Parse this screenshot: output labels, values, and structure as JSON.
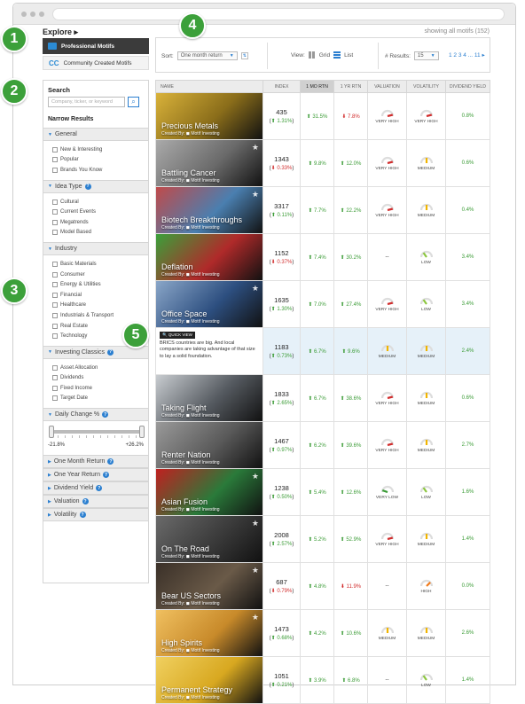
{
  "badges": [
    "1",
    "2",
    "3",
    "4",
    "5"
  ],
  "explore": "Explore",
  "showing": "showing all motifs (152)",
  "tabs": {
    "pro": "Professional Motifs",
    "community": "Community Created Motifs"
  },
  "toolbar": {
    "sort_label": "Sort:",
    "sort_value": "One month return",
    "view_label": "View:",
    "grid": "Grid",
    "list": "List",
    "results_label": "# Results:",
    "results_value": "15",
    "pages": "1  2  3  4 ... 11 ▸"
  },
  "sidebar": {
    "search_title": "Search",
    "search_placeholder": "Company, ticker, or keyword",
    "narrow": "Narrow Results",
    "general": {
      "title": "General",
      "items": [
        "New & Interesting",
        "Popular",
        "Brands You Know"
      ]
    },
    "idea": {
      "title": "Idea Type",
      "items": [
        "Cultural",
        "Current Events",
        "Megatrends",
        "Model Based"
      ]
    },
    "industry": {
      "title": "Industry",
      "items": [
        "Basic Materials",
        "Consumer",
        "Energy & Utilities",
        "Financial",
        "Healthcare",
        "Industrials & Transport",
        "Real Estate",
        "Technology"
      ]
    },
    "classics": {
      "title": "Investing Classics",
      "items": [
        "Asset Allocation",
        "Dividends",
        "Fixed Income",
        "Target Date"
      ]
    },
    "daily": {
      "title": "Daily Change %",
      "lo": "-21.8%",
      "hi": "+26.2%"
    },
    "collapsed": [
      "One Month Return",
      "One Year Return",
      "Dividend Yield",
      "Valuation",
      "Volatility"
    ]
  },
  "table": {
    "headers": [
      "NAME",
      "INDEX",
      "1 MO RTN",
      "1 YR RTN",
      "VALUATION",
      "VOLATILITY",
      "DIVIDEND YIELD"
    ],
    "created_by": "Created By:",
    "creator": "Motif Investing",
    "quick_view": "QUICK VIEW",
    "rows": [
      {
        "name": "Precious Metals",
        "index": "435",
        "change": "1.31%",
        "chg_dir": "up",
        "mo": "31.5%",
        "mo_dir": "up",
        "yr": "7.8%",
        "yr_dir": "dn",
        "val": "VERY HIGH",
        "vol": "VERY HIGH",
        "div": "0.8%",
        "bg": "#8a6d1a",
        "accent": "#d9b23a",
        "star": false
      },
      {
        "name": "Battling Cancer",
        "index": "1343",
        "change": "0.33%",
        "chg_dir": "dn",
        "mo": "9.8%",
        "mo_dir": "up",
        "yr": "12.0%",
        "yr_dir": "up",
        "val": "VERY HIGH",
        "vol": "MEDIUM",
        "div": "0.6%",
        "bg": "#6a6a6a",
        "accent": "#aaaaaa",
        "star": true
      },
      {
        "name": "Biotech Breakthroughs",
        "index": "3317",
        "change": "0.11%",
        "chg_dir": "up",
        "mo": "7.7%",
        "mo_dir": "up",
        "yr": "22.2%",
        "yr_dir": "up",
        "val": "VERY HIGH",
        "vol": "MEDIUM",
        "div": "0.4%",
        "bg": "#4a7fb0",
        "accent": "#c04a4a",
        "star": true
      },
      {
        "name": "Deflation",
        "index": "1152",
        "change": "0.37%",
        "chg_dir": "dn",
        "mo": "7.4%",
        "mo_dir": "up",
        "yr": "30.2%",
        "yr_dir": "up",
        "val": "--",
        "vol": "LOW",
        "div": "3.4%",
        "bg": "#b02a2a",
        "accent": "#3aa03a",
        "star": false
      },
      {
        "name": "Office Space",
        "index": "1635",
        "change": "1.30%",
        "chg_dir": "up",
        "mo": "7.0%",
        "mo_dir": "up",
        "yr": "27.4%",
        "yr_dir": "up",
        "val": "VERY HIGH",
        "vol": "LOW",
        "div": "3.4%",
        "bg": "#2d4f80",
        "accent": "#8aa6c8",
        "star": true
      },
      {
        "name": "BRICS",
        "quick": "BRICS countries are big. And local companies are taking advantage of that size to lay a solid foundation.",
        "index": "1183",
        "change": "0.73%",
        "chg_dir": "up",
        "mo": "6.7%",
        "mo_dir": "up",
        "yr": "9.6%",
        "yr_dir": "up",
        "val": "MEDIUM",
        "vol": "MEDIUM",
        "div": "2.4%",
        "bg": "#ffffff",
        "accent": "#ffffff",
        "star": false
      },
      {
        "name": "Taking Flight",
        "index": "1833",
        "change": "2.65%",
        "chg_dir": "up",
        "mo": "6.7%",
        "mo_dir": "up",
        "yr": "38.6%",
        "yr_dir": "up",
        "val": "VERY HIGH",
        "vol": "MEDIUM",
        "div": "0.6%",
        "bg": "#555a60",
        "accent": "#c8ccd0",
        "star": false
      },
      {
        "name": "Renter Nation",
        "index": "1467",
        "change": "0.97%",
        "chg_dir": "up",
        "mo": "6.2%",
        "mo_dir": "up",
        "yr": "39.6%",
        "yr_dir": "up",
        "val": "VERY HIGH",
        "vol": "MEDIUM",
        "div": "2.7%",
        "bg": "#5a5a5a",
        "accent": "#9a9a9a",
        "star": false
      },
      {
        "name": "Asian Fusion",
        "index": "1238",
        "change": "0.50%",
        "chg_dir": "up",
        "mo": "5.4%",
        "mo_dir": "up",
        "yr": "12.6%",
        "yr_dir": "up",
        "val": "VERY LOW",
        "vol": "LOW",
        "div": "1.6%",
        "bg": "#2a7a3a",
        "accent": "#c02020",
        "star": true
      },
      {
        "name": "On The Road",
        "index": "2008",
        "change": "2.57%",
        "chg_dir": "up",
        "mo": "5.2%",
        "mo_dir": "up",
        "yr": "52.9%",
        "yr_dir": "up",
        "val": "VERY HIGH",
        "vol": "MEDIUM",
        "div": "1.4%",
        "bg": "#3a3a3a",
        "accent": "#6a6a6a",
        "star": true
      },
      {
        "name": "Bear US Sectors",
        "index": "687",
        "change": "0.79%",
        "chg_dir": "dn",
        "mo": "4.8%",
        "mo_dir": "up",
        "yr": "11.9%",
        "yr_dir": "dn",
        "val": "--",
        "vol": "HIGH",
        "div": "0.0%",
        "bg": "#6a5a48",
        "accent": "#3a3028",
        "star": true
      },
      {
        "name": "High Spirits",
        "index": "1473",
        "change": "0.68%",
        "chg_dir": "up",
        "mo": "4.2%",
        "mo_dir": "up",
        "yr": "10.6%",
        "yr_dir": "up",
        "val": "MEDIUM",
        "vol": "MEDIUM",
        "div": "2.6%",
        "bg": "#c88a2a",
        "accent": "#f0c060",
        "star": true
      },
      {
        "name": "Permanent Strategy",
        "index": "1051",
        "change": "0.21%",
        "chg_dir": "up",
        "mo": "3.9%",
        "mo_dir": "up",
        "yr": "6.8%",
        "yr_dir": "up",
        "val": "--",
        "vol": "LOW",
        "div": "1.4%",
        "bg": "#d8a820",
        "accent": "#f0d060",
        "star": false
      }
    ]
  },
  "colors": {
    "accent": "#2b7fd0",
    "badge": "#3ca03a",
    "up": "#3a9b35",
    "down": "#d12c2c"
  }
}
